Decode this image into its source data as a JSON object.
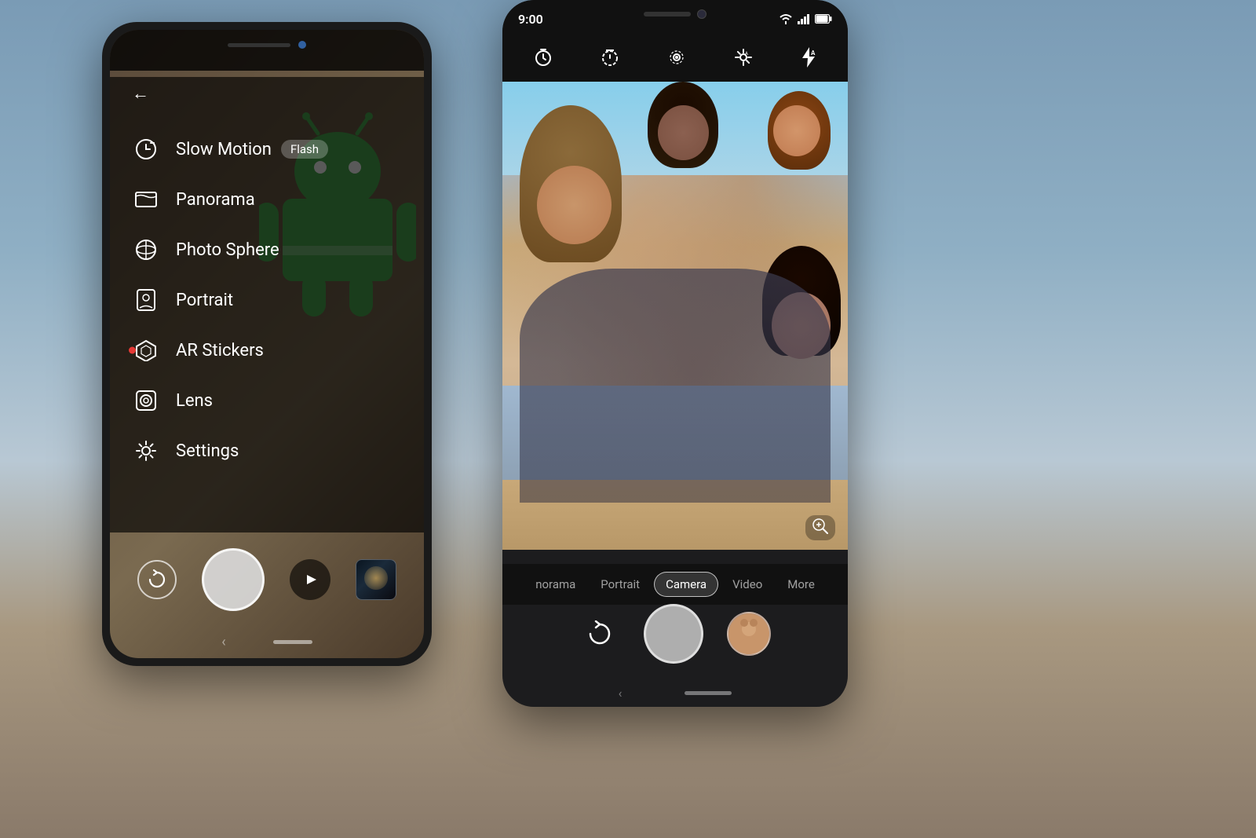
{
  "background": {
    "color_top": "#7a9bb5",
    "color_mid": "#8fafc4",
    "color_bottom": "#8a7a6a"
  },
  "phone_left": {
    "back_arrow": "←",
    "menu_items": [
      {
        "id": "slow-motion",
        "icon": "⊙",
        "label": "Slow Motion",
        "badge": "Flash"
      },
      {
        "id": "panorama",
        "icon": "⛰",
        "label": "Panorama",
        "badge": ""
      },
      {
        "id": "photo-sphere",
        "icon": "◎",
        "label": "Photo Sphere",
        "badge": ""
      },
      {
        "id": "portrait",
        "icon": "👤",
        "label": "Portrait",
        "badge": ""
      },
      {
        "id": "ar-stickers",
        "icon": "❋",
        "label": "AR Stickers",
        "badge": "",
        "dot": true
      },
      {
        "id": "lens",
        "icon": "⊡",
        "label": "Lens",
        "badge": ""
      },
      {
        "id": "settings",
        "icon": "⚙",
        "label": "Settings",
        "badge": ""
      }
    ],
    "bottom_controls": {
      "rotate_label": "↻",
      "video_label": "🎥"
    }
  },
  "phone_right": {
    "status_bar": {
      "time": "9:00",
      "wifi_icon": "wifi",
      "signal_icon": "signal",
      "battery_icon": "battery"
    },
    "top_icons": [
      "⏱",
      "⊙",
      "⊛",
      "❄",
      "⚡"
    ],
    "mode_tabs": [
      {
        "id": "panorama",
        "label": "norama",
        "active": false
      },
      {
        "id": "portrait",
        "label": "Portrait",
        "active": false
      },
      {
        "id": "camera",
        "label": "Camera",
        "active": true
      },
      {
        "id": "video",
        "label": "Video",
        "active": false
      },
      {
        "id": "more",
        "label": "More",
        "active": false
      }
    ],
    "zoom_label": "⊕",
    "rotate_label": "↻"
  }
}
